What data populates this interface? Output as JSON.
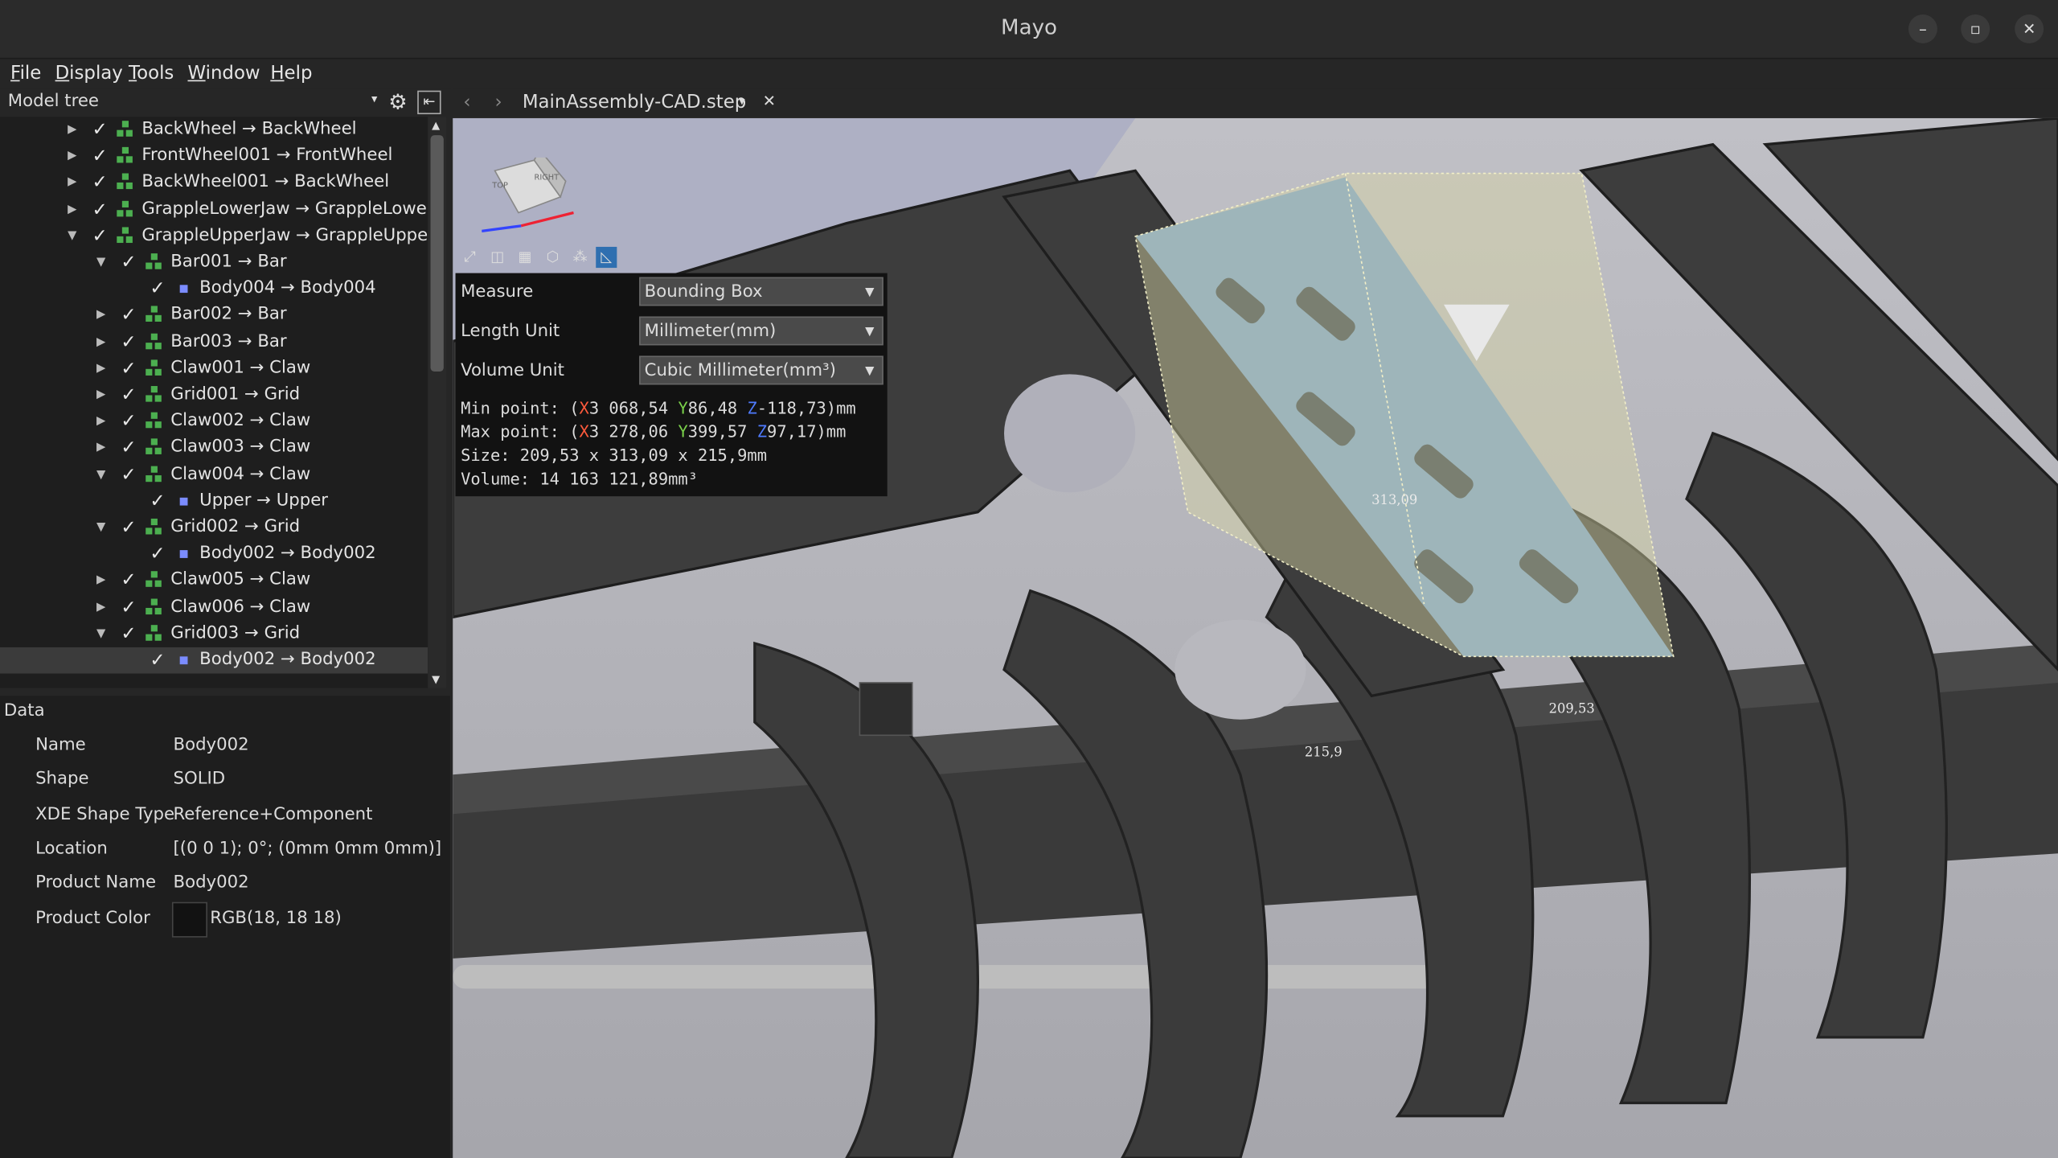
{
  "app": {
    "title": "Mayo"
  },
  "menu": [
    "File",
    "Display",
    "Tools",
    "Window",
    "Help"
  ],
  "left": {
    "header": "Model tree"
  },
  "tree": [
    {
      "indent": 0,
      "arrow": "right",
      "label": "BackWheel → BackWheel",
      "kind": "asm"
    },
    {
      "indent": 0,
      "arrow": "right",
      "label": "FrontWheel001 → FrontWheel",
      "kind": "asm"
    },
    {
      "indent": 0,
      "arrow": "right",
      "label": "BackWheel001 → BackWheel",
      "kind": "asm"
    },
    {
      "indent": 0,
      "arrow": "right",
      "label": "GrappleLowerJaw → GrappleLower",
      "kind": "asm"
    },
    {
      "indent": 0,
      "arrow": "down",
      "label": "GrappleUpperJaw → GrappleUppe",
      "kind": "asm"
    },
    {
      "indent": 1,
      "arrow": "down",
      "label": "Bar001 → Bar",
      "kind": "asm"
    },
    {
      "indent": 2,
      "arrow": "",
      "label": "Body004 → Body004",
      "kind": "part"
    },
    {
      "indent": 1,
      "arrow": "right",
      "label": "Bar002 → Bar",
      "kind": "asm"
    },
    {
      "indent": 1,
      "arrow": "right",
      "label": "Bar003 → Bar",
      "kind": "asm"
    },
    {
      "indent": 1,
      "arrow": "right",
      "label": "Claw001 → Claw",
      "kind": "asm"
    },
    {
      "indent": 1,
      "arrow": "right",
      "label": "Grid001 → Grid",
      "kind": "asm"
    },
    {
      "indent": 1,
      "arrow": "right",
      "label": "Claw002 → Claw",
      "kind": "asm"
    },
    {
      "indent": 1,
      "arrow": "right",
      "label": "Claw003 → Claw",
      "kind": "asm"
    },
    {
      "indent": 1,
      "arrow": "down",
      "label": "Claw004 → Claw",
      "kind": "asm"
    },
    {
      "indent": 2,
      "arrow": "",
      "label": "Upper → Upper",
      "kind": "part"
    },
    {
      "indent": 1,
      "arrow": "down",
      "label": "Grid002 → Grid",
      "kind": "asm"
    },
    {
      "indent": 2,
      "arrow": "",
      "label": "Body002 → Body002",
      "kind": "part"
    },
    {
      "indent": 1,
      "arrow": "right",
      "label": "Claw005 → Claw",
      "kind": "asm"
    },
    {
      "indent": 1,
      "arrow": "right",
      "label": "Claw006 → Claw",
      "kind": "asm"
    },
    {
      "indent": 1,
      "arrow": "down",
      "label": "Grid003 → Grid",
      "kind": "asm"
    },
    {
      "indent": 2,
      "arrow": "",
      "label": "Body002 → Body002",
      "kind": "part",
      "selected": true
    }
  ],
  "data": {
    "header": "Data",
    "rows": [
      {
        "name": "Name",
        "value": "Body002"
      },
      {
        "name": "Shape",
        "value": "SOLID"
      },
      {
        "name": "XDE Shape Type",
        "value": "Reference+Component"
      },
      {
        "name": "Location",
        "value": "[(0 0 1); 0°; (0mm 0mm 0mm)]"
      },
      {
        "name": "Product Name",
        "value": "Body002"
      },
      {
        "name": "Product Color",
        "value": "RGB(18, 18 18)"
      }
    ],
    "color_swatch": "#121212"
  },
  "tab": {
    "filename": "MainAssembly-CAD.step"
  },
  "measure": {
    "measure_label": "Measure",
    "measure_value": "Bounding Box",
    "length_label": "Length Unit",
    "length_value": "Millimeter(mm)",
    "volume_label": "Volume Unit",
    "volume_value": "Cubic Millimeter(mm³)",
    "min_x": "3 068,54",
    "min_y": "86,48",
    "min_z": "-118,73",
    "max_x": "3 278,06",
    "max_y": "399,57",
    "max_z": "97,17",
    "size": "Size: 209,53 x 313,09 x 215,9mm",
    "volume": "Volume: 14 163 121,89mm³"
  },
  "dims": {
    "d1": "313,09",
    "d2": "209,53",
    "d3": "215,9"
  },
  "viewcube": {
    "top": "TOP",
    "right": "RIGHT"
  },
  "colors": {
    "accent": "#4caf50",
    "selection_blue": "#6f9ccc",
    "bbox": "#d8d4a4"
  }
}
